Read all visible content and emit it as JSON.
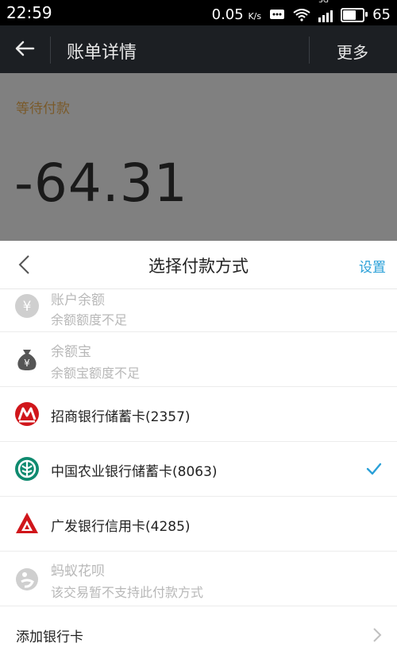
{
  "status_bar": {
    "time": "22:59",
    "speed": "0.05",
    "speed_unit": "K/s",
    "network": "3G",
    "battery": "65"
  },
  "appbar": {
    "title": "账单详情",
    "more_label": "更多"
  },
  "background": {
    "status": "等待付款",
    "amount": "-64.31"
  },
  "sheet": {
    "title": "选择付款方式",
    "settings_label": "设置",
    "options": [
      {
        "label": "账户余额",
        "sub": "余额额度不足",
        "icon": "yuan-coin-icon",
        "enabled": false
      },
      {
        "label": "余额宝",
        "sub": "余额宝额度不足",
        "icon": "money-bag-icon",
        "enabled": false
      },
      {
        "label": "招商银行储蓄卡(2357)",
        "icon": "cmb-bank-icon",
        "enabled": true
      },
      {
        "label": "中国农业银行储蓄卡(8063)",
        "icon": "abc-bank-icon",
        "enabled": true,
        "selected": true
      },
      {
        "label": "广发银行信用卡(4285)",
        "icon": "cgb-bank-icon",
        "enabled": true
      },
      {
        "label": "蚂蚁花呗",
        "sub": "该交易暂不支持此付款方式",
        "icon": "huabei-icon",
        "enabled": false
      }
    ],
    "add_card_label": "添加银行卡"
  },
  "colors": {
    "accent": "#2aa0d8",
    "dim_overlay": "#808080",
    "appbar": "#1c1f23"
  }
}
